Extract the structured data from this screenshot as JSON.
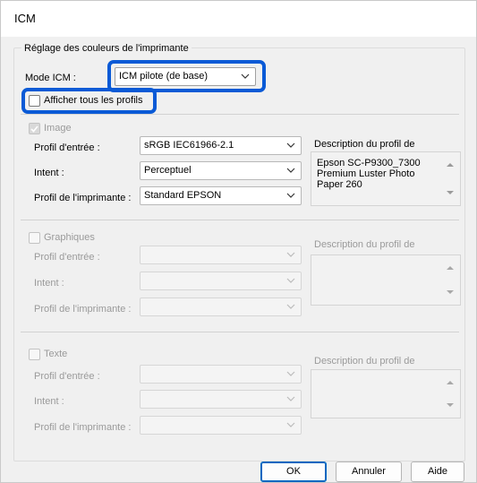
{
  "window": {
    "title": "ICM"
  },
  "group": {
    "legend": "Réglage des couleurs de l'imprimante"
  },
  "mode": {
    "label": "Mode ICM :",
    "value": "ICM pilote (de base)",
    "show_all_profiles": "Afficher tous les profils"
  },
  "image": {
    "title": "Image",
    "input_profile_label": "Profil d'entrée :",
    "input_profile_value": "sRGB IEC61966-2.1",
    "intent_label": "Intent :",
    "intent_value": "Perceptuel",
    "printer_profile_label": "Profil de l'imprimante :",
    "printer_profile_value": "Standard EPSON",
    "description_label": "Description du profil de",
    "description_text": "Epson SC-P9300_7300\nPremium Luster Photo\nPaper 260"
  },
  "graphics": {
    "title": "Graphiques",
    "input_profile_label": "Profil d'entrée :",
    "intent_label": "Intent :",
    "printer_profile_label": "Profil de l'imprimante :",
    "description_label": "Description du profil de"
  },
  "text": {
    "title": "Texte",
    "input_profile_label": "Profil d'entrée :",
    "intent_label": "Intent :",
    "printer_profile_label": "Profil de l'imprimante :",
    "description_label": "Description du profil de"
  },
  "buttons": {
    "ok": "OK",
    "cancel": "Annuler",
    "help": "Aide"
  },
  "colors": {
    "highlight": "#0a5ad6",
    "default_button": "#0067c0",
    "disabled_text": "#9a9a9a"
  }
}
